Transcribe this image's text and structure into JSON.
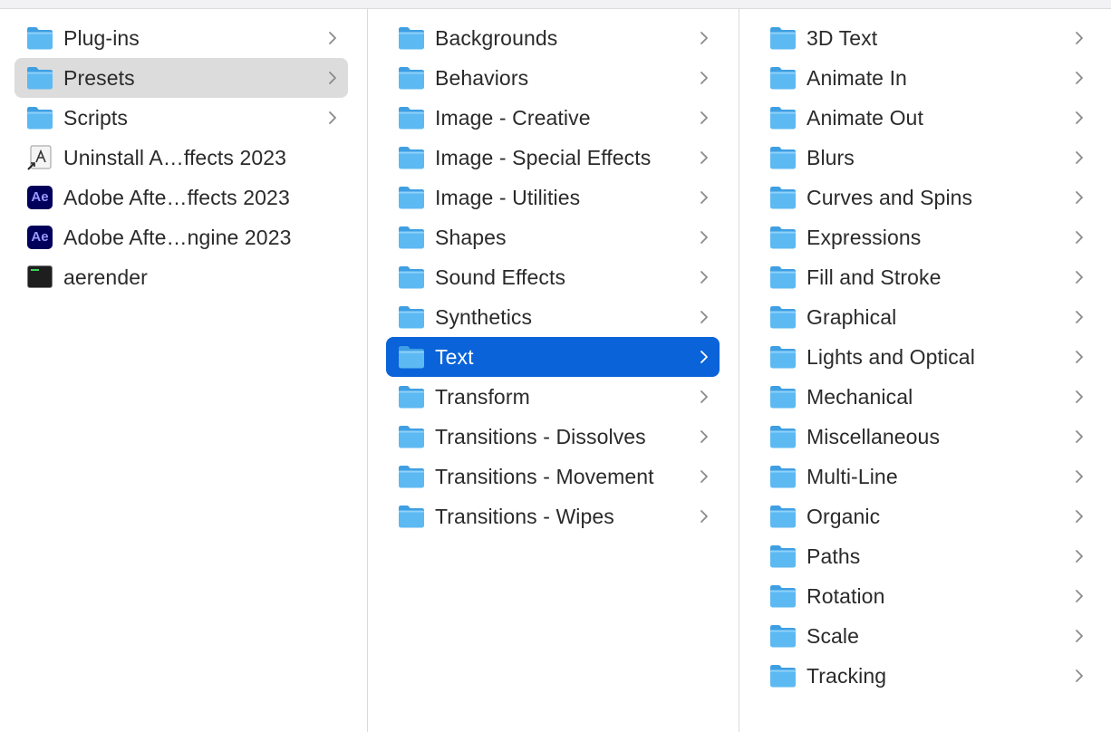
{
  "columns": {
    "col1": {
      "items": [
        {
          "label": "Plug-ins",
          "icon": "folder-icon",
          "chevron": true
        },
        {
          "label": "Presets",
          "icon": "folder-icon",
          "chevron": true,
          "selected": true
        },
        {
          "label": "Scripts",
          "icon": "folder-icon",
          "chevron": true
        },
        {
          "label": "Uninstall A…ffects 2023",
          "icon": "uninstaller-app-icon",
          "chevron": false
        },
        {
          "label": "Adobe Afte…ffects 2023",
          "icon": "after-effects-app-icon",
          "chevron": false
        },
        {
          "label": "Adobe Afte…ngine 2023",
          "icon": "after-effects-app-icon",
          "chevron": false
        },
        {
          "label": "aerender",
          "icon": "terminal-executable-icon",
          "chevron": false
        }
      ],
      "ae_icon_text": "Ae"
    },
    "col2": {
      "items": [
        {
          "label": "Backgrounds"
        },
        {
          "label": "Behaviors"
        },
        {
          "label": "Image - Creative"
        },
        {
          "label": "Image - Special Effects"
        },
        {
          "label": "Image - Utilities"
        },
        {
          "label": "Shapes"
        },
        {
          "label": "Sound Effects"
        },
        {
          "label": "Synthetics"
        },
        {
          "label": "Text",
          "selected": true
        },
        {
          "label": "Transform"
        },
        {
          "label": "Transitions - Dissolves"
        },
        {
          "label": "Transitions - Movement"
        },
        {
          "label": "Transitions - Wipes"
        }
      ]
    },
    "col3": {
      "items": [
        {
          "label": "3D Text"
        },
        {
          "label": "Animate In"
        },
        {
          "label": "Animate Out"
        },
        {
          "label": "Blurs"
        },
        {
          "label": "Curves and Spins"
        },
        {
          "label": "Expressions"
        },
        {
          "label": "Fill and Stroke"
        },
        {
          "label": "Graphical"
        },
        {
          "label": "Lights and Optical"
        },
        {
          "label": "Mechanical"
        },
        {
          "label": "Miscellaneous"
        },
        {
          "label": "Multi-Line"
        },
        {
          "label": "Organic"
        },
        {
          "label": "Paths"
        },
        {
          "label": "Rotation"
        },
        {
          "label": "Scale"
        },
        {
          "label": "Tracking"
        }
      ]
    }
  },
  "colors": {
    "selection_active": "#0a63d9",
    "selection_inactive": "#dcdcdc",
    "folder_body": "#5bb8f0",
    "folder_tab": "#4aa6e6"
  }
}
